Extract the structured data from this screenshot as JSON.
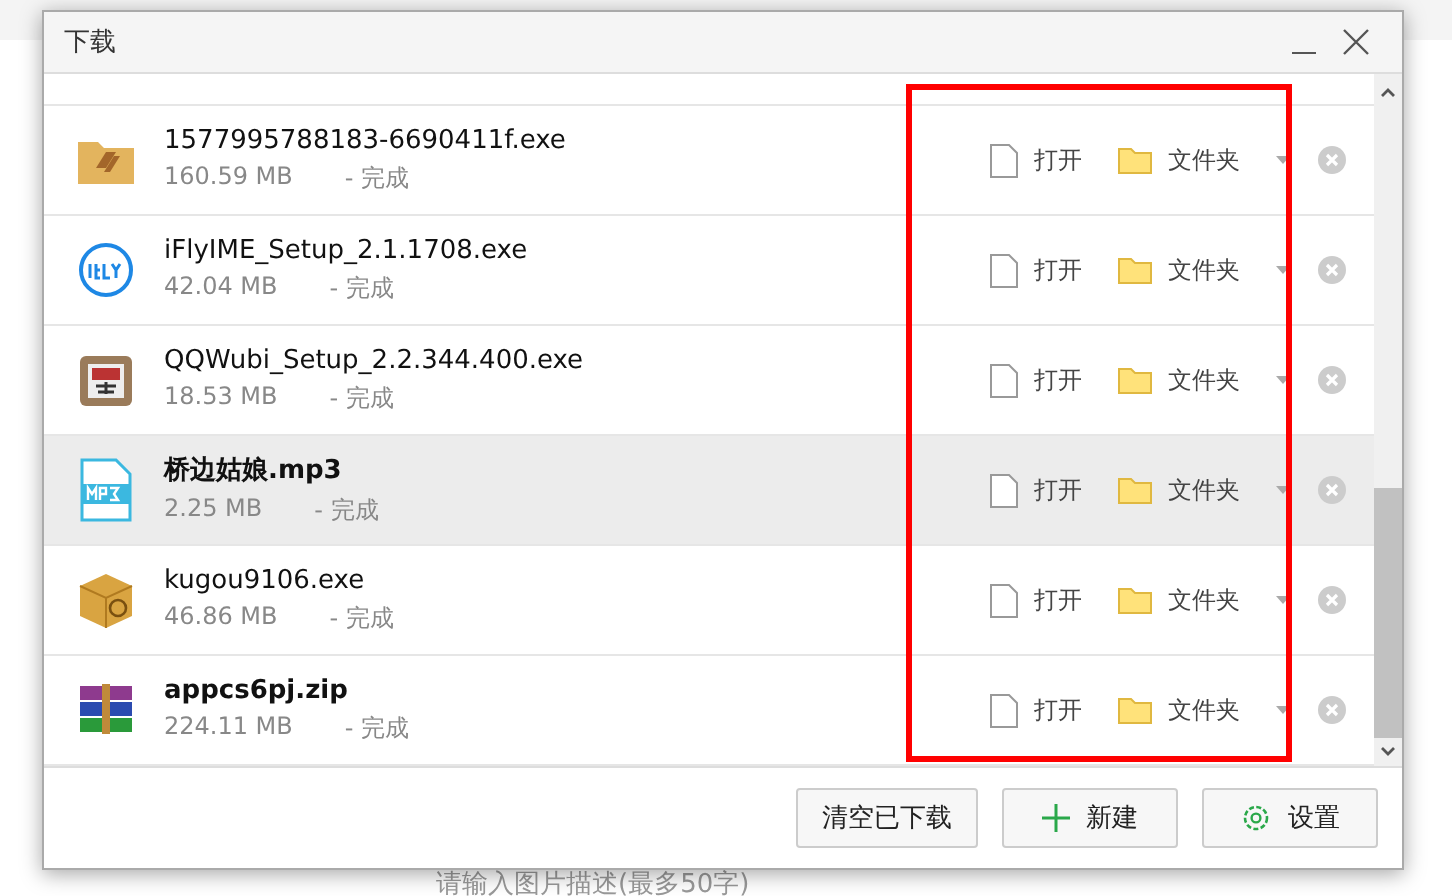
{
  "page": {
    "caption_placeholder": "请输入图片描述(最多50字)"
  },
  "window": {
    "title": "下载"
  },
  "downloads": [
    {
      "kind": "folder-app",
      "name": "1577995788183-6690411f.exe",
      "size": "160.59 MB",
      "status": "- 完成",
      "bold": false,
      "hovered": false,
      "open": "打开",
      "folder": "文件夹"
    },
    {
      "kind": "ifly",
      "name": "iFlyIME_Setup_2.1.1708.exe",
      "size": "42.04 MB",
      "status": "- 完成",
      "bold": false,
      "hovered": false,
      "open": "打开",
      "folder": "文件夹"
    },
    {
      "kind": "wubi",
      "name": "QQWubi_Setup_2.2.344.400.exe",
      "size": "18.53 MB",
      "status": "- 完成",
      "bold": false,
      "hovered": false,
      "open": "打开",
      "folder": "文件夹"
    },
    {
      "kind": "mp3",
      "name": "桥边姑娘.mp3",
      "size": "2.25 MB",
      "status": "- 完成",
      "bold": true,
      "hovered": true,
      "open": "打开",
      "folder": "文件夹"
    },
    {
      "kind": "box",
      "name": "kugou9106.exe",
      "size": "46.86 MB",
      "status": "- 完成",
      "bold": false,
      "hovered": false,
      "open": "打开",
      "folder": "文件夹"
    },
    {
      "kind": "archive",
      "name": "appcs6pj.zip",
      "size": "224.11 MB",
      "status": "- 完成",
      "bold": true,
      "hovered": false,
      "open": "打开",
      "folder": "文件夹"
    }
  ],
  "footer": {
    "buttons": [
      {
        "kind": "plain",
        "label": "清空已下载"
      },
      {
        "kind": "new",
        "label": "新建"
      },
      {
        "kind": "settings",
        "label": "设置"
      }
    ]
  }
}
